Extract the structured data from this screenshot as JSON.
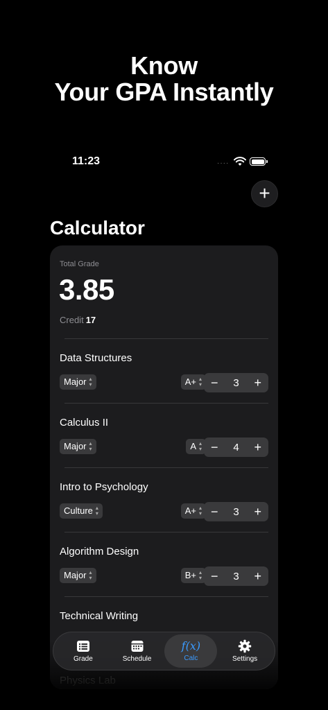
{
  "headline": {
    "line1": "Know",
    "line2": "Your GPA Instantly"
  },
  "status_bar": {
    "time": "11:23",
    "dots": "····"
  },
  "screen": {
    "title": "Calculator"
  },
  "summary": {
    "total_label": "Total Grade",
    "gpa": "3.85",
    "credit_label": "Credit",
    "credit_value": "17"
  },
  "courses": [
    {
      "name": "Data Structures",
      "type": "Major",
      "grade": "A+",
      "credits": "3"
    },
    {
      "name": "Calculus II",
      "type": "Major",
      "grade": "A",
      "credits": "4"
    },
    {
      "name": "Intro to Psychology",
      "type": "Culture",
      "grade": "A+",
      "credits": "3"
    },
    {
      "name": "Algorithm Design",
      "type": "Major",
      "grade": "B+",
      "credits": "3"
    },
    {
      "name": "Technical Writing"
    },
    {
      "name": "Physics Lab"
    }
  ],
  "stepper": {
    "minus": "−",
    "plus": "+"
  },
  "tabs": [
    {
      "label": "Grade",
      "icon": "list-icon"
    },
    {
      "label": "Schedule",
      "icon": "calendar-icon"
    },
    {
      "label": "Calc",
      "icon": "function-icon",
      "glyph": "f(x)",
      "active": true
    },
    {
      "label": "Settings",
      "icon": "gear-icon"
    }
  ],
  "colors": {
    "background": "#000000",
    "card": "#1c1c1e",
    "chip": "#3a3a3c",
    "accent": "#3a9bff"
  }
}
